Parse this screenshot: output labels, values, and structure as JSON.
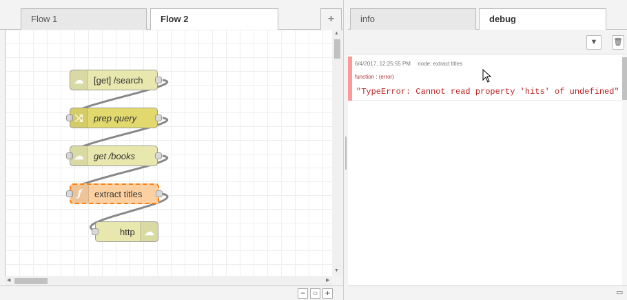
{
  "workspace": {
    "tabs": [
      {
        "label": "Flow 1",
        "active": false
      },
      {
        "label": "Flow 2",
        "active": true
      }
    ],
    "add_tab_icon": "plus-icon",
    "nodes": [
      {
        "label": "[get] /search",
        "type": "http in",
        "icon": "globe-icon"
      },
      {
        "label": "prep query",
        "type": "change",
        "icon": "shuffle-icon"
      },
      {
        "label": "get /books",
        "type": "http request",
        "icon": "globe-icon"
      },
      {
        "label": "extract titles",
        "type": "function",
        "icon": "function-icon"
      },
      {
        "label": "http",
        "type": "http response",
        "icon": "globe-icon"
      }
    ],
    "zoom_controls": [
      "zoom-out-icon",
      "zoom-reset-icon",
      "zoom-in-icon"
    ]
  },
  "sidebar": {
    "tabs": [
      {
        "label": "info",
        "active": false
      },
      {
        "label": "debug",
        "active": true
      }
    ],
    "toolbar": [
      "filter-icon",
      "trash-icon"
    ],
    "messages": [
      {
        "timestamp": "6/4/2017, 12:25:55 PM",
        "node": "node: extract titles",
        "topic": "function : (error)",
        "payload": "\"TypeError: Cannot read property 'hits' of undefined\""
      }
    ],
    "footer_icon": "monitor-icon"
  },
  "colors": {
    "http_node": "#e7e7ae",
    "function_node": "#fdd0a2",
    "change_node": "#e2d96e",
    "selected_outline": "#ff7f0e",
    "error_bar": "#ff9999",
    "error_text": "#bb2222"
  }
}
